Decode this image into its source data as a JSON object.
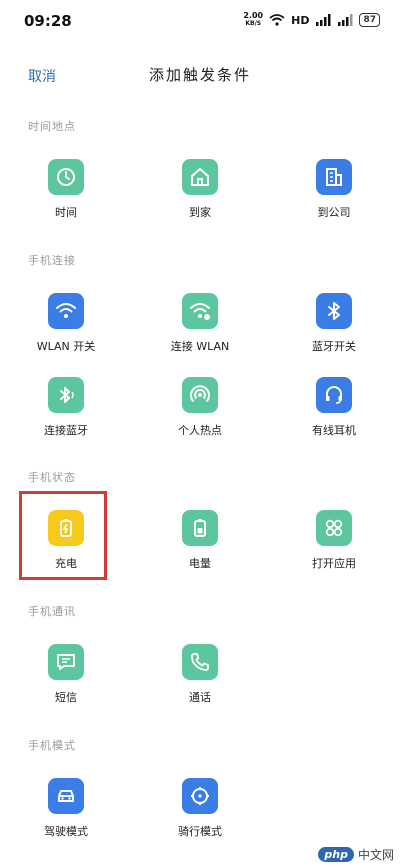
{
  "status_bar": {
    "time": "09:28",
    "net_speed_value": "2.00",
    "net_speed_unit": "KB/S",
    "hd": "HD",
    "battery": "87"
  },
  "header": {
    "cancel_label": "取消",
    "title": "添加触发条件"
  },
  "sections": [
    {
      "title": "时间地点",
      "items": [
        {
          "label": "时间",
          "icon": "clock-icon",
          "color": "#5cc79e"
        },
        {
          "label": "到家",
          "icon": "home-icon",
          "color": "#5cc79e"
        },
        {
          "label": "到公司",
          "icon": "office-building-icon",
          "color": "#3a7de6"
        }
      ]
    },
    {
      "title": "手机连接",
      "items": [
        {
          "label": "WLAN 开关",
          "icon": "wifi-icon",
          "color": "#3a7de6"
        },
        {
          "label": "连接 WLAN",
          "icon": "wifi-connect-icon",
          "color": "#5cc79e"
        },
        {
          "label": "蓝牙开关",
          "icon": "bluetooth-icon",
          "color": "#3a7de6"
        },
        {
          "label": "连接蓝牙",
          "icon": "bluetooth-connect-icon",
          "color": "#5cc79e"
        },
        {
          "label": "个人热点",
          "icon": "hotspot-icon",
          "color": "#5cc79e"
        },
        {
          "label": "有线耳机",
          "icon": "headset-icon",
          "color": "#3a7de6"
        }
      ]
    },
    {
      "title": "手机状态",
      "items": [
        {
          "label": "充电",
          "icon": "charging-icon",
          "color": "#f6c91c"
        },
        {
          "label": "电量",
          "icon": "battery-icon",
          "color": "#5cc79e"
        },
        {
          "label": "打开应用",
          "icon": "apps-icon",
          "color": "#5cc79e"
        }
      ]
    },
    {
      "title": "手机通讯",
      "items": [
        {
          "label": "短信",
          "icon": "message-icon",
          "color": "#5cc79e"
        },
        {
          "label": "通话",
          "icon": "phone-icon",
          "color": "#5cc79e"
        }
      ]
    },
    {
      "title": "手机模式",
      "items": [
        {
          "label": "驾驶模式",
          "icon": "car-icon",
          "color": "#3a7de6"
        },
        {
          "label": "骑行模式",
          "icon": "compass-icon",
          "color": "#3a7de6"
        }
      ]
    }
  ],
  "watermark": {
    "badge": "php",
    "text": "中文网"
  }
}
